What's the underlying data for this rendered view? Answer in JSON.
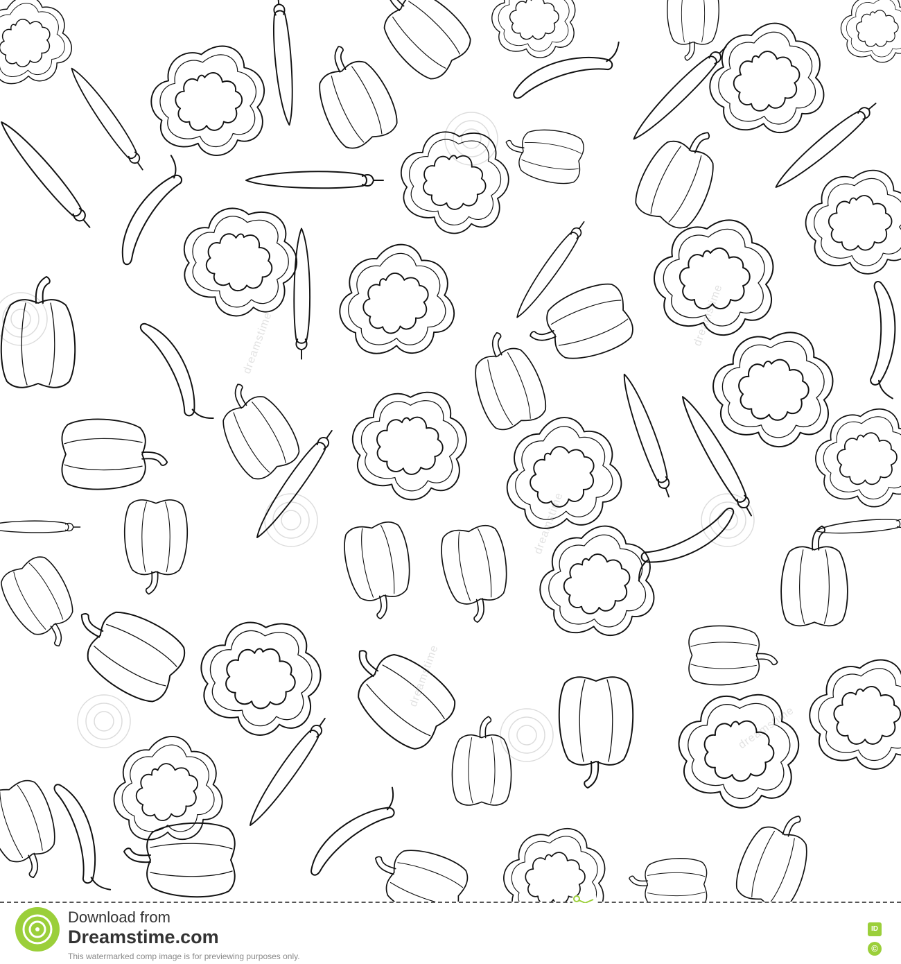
{
  "footer": {
    "download_text": "Download from",
    "site_name": "Dreamstime.com",
    "notice": "This watermarked comp image is for previewing purposes only.",
    "id_badge": "ID",
    "copyright_symbol": "©"
  },
  "pattern": {
    "subject": "hand-drawn line-art peppers (seamless pattern)",
    "watermark_text": "dreamstime",
    "colors": {
      "line": "#111111",
      "background": "#ffffff",
      "brand_green": "#9bcf3a"
    },
    "icons": [
      "bell-pepper-icon",
      "pepper-slice-icon",
      "chili-pepper-icon",
      "scissors-icon",
      "dreamstime-logo-icon"
    ]
  }
}
